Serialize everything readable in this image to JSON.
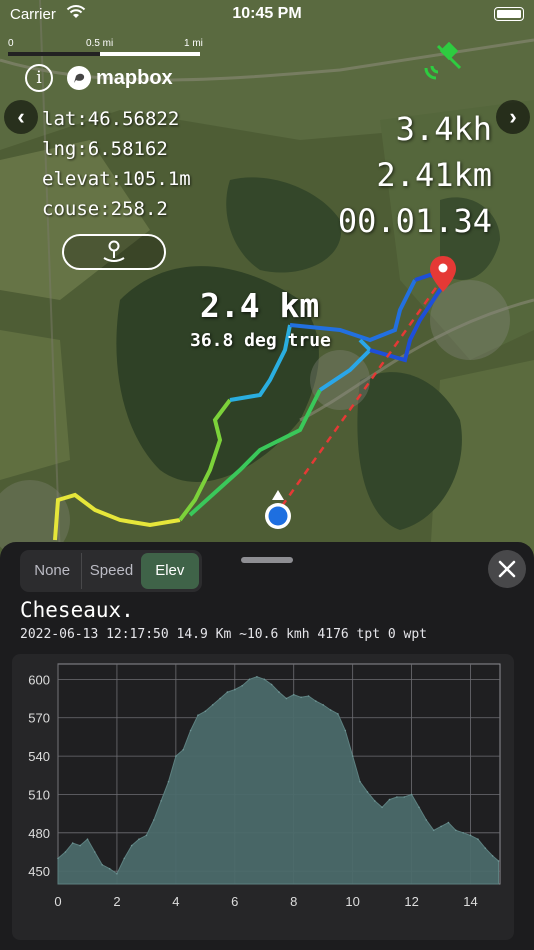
{
  "status_bar": {
    "carrier": "Carrier",
    "time": "10:45 PM"
  },
  "map": {
    "scale": {
      "zero": "0",
      "half": "0.5 mi",
      "one": "1 mi"
    },
    "attribution": "mapbox",
    "coords": {
      "lat": "lat:46.56822",
      "lng": "lng:6.58162",
      "elevation": "elevat:105.1m",
      "course": "couse:258.2"
    },
    "stats": {
      "speed": "3.4kh",
      "distance": "2.41km",
      "duration": "00.01.34"
    },
    "target": {
      "distance": "2.4 km",
      "bearing": "36.8 deg true"
    }
  },
  "sheet": {
    "segments": [
      "None",
      "Speed",
      "Elev"
    ],
    "active_segment": "Elev",
    "track_name": "Cheseaux.",
    "track_meta": "2022-06-13 12:17:50 14.9 Km ~10.6 kmh 4176 tpt 0 wpt"
  },
  "colors": {
    "accent_green": "#3f6348",
    "chart_fill": "#4b6a6a",
    "route_red": "#e53935",
    "location_blue": "#1e6fe0"
  },
  "chart_data": {
    "type": "area",
    "x": [
      0,
      0.25,
      0.5,
      0.75,
      1.0,
      1.25,
      1.5,
      1.75,
      2.0,
      2.25,
      2.5,
      2.75,
      3.0,
      3.25,
      3.5,
      3.75,
      4.0,
      4.25,
      4.5,
      4.75,
      5.0,
      5.25,
      5.5,
      5.75,
      6.0,
      6.25,
      6.5,
      6.75,
      7.0,
      7.25,
      7.5,
      7.75,
      8.0,
      8.25,
      8.5,
      8.75,
      9.0,
      9.25,
      9.5,
      9.75,
      10.0,
      10.25,
      10.5,
      10.75,
      11.0,
      11.25,
      11.5,
      11.75,
      12.0,
      12.25,
      12.5,
      12.75,
      13.0,
      13.25,
      13.5,
      13.75,
      14.0,
      14.25,
      14.5,
      14.75,
      14.95
    ],
    "values": [
      460,
      465,
      472,
      470,
      475,
      465,
      455,
      452,
      448,
      460,
      470,
      475,
      478,
      490,
      505,
      520,
      540,
      545,
      560,
      572,
      575,
      580,
      585,
      590,
      592,
      595,
      600,
      602,
      600,
      596,
      590,
      585,
      588,
      586,
      587,
      583,
      580,
      576,
      573,
      560,
      540,
      520,
      512,
      505,
      500,
      506,
      508,
      508,
      510,
      500,
      490,
      482,
      485,
      488,
      482,
      480,
      478,
      475,
      468,
      462,
      458
    ],
    "ylim": [
      440,
      612
    ],
    "xlim": [
      0,
      15
    ],
    "yticks": [
      450,
      480,
      510,
      540,
      570,
      600
    ],
    "xticks": [
      0,
      2,
      4,
      6,
      8,
      10,
      12,
      14
    ],
    "grid": true
  }
}
